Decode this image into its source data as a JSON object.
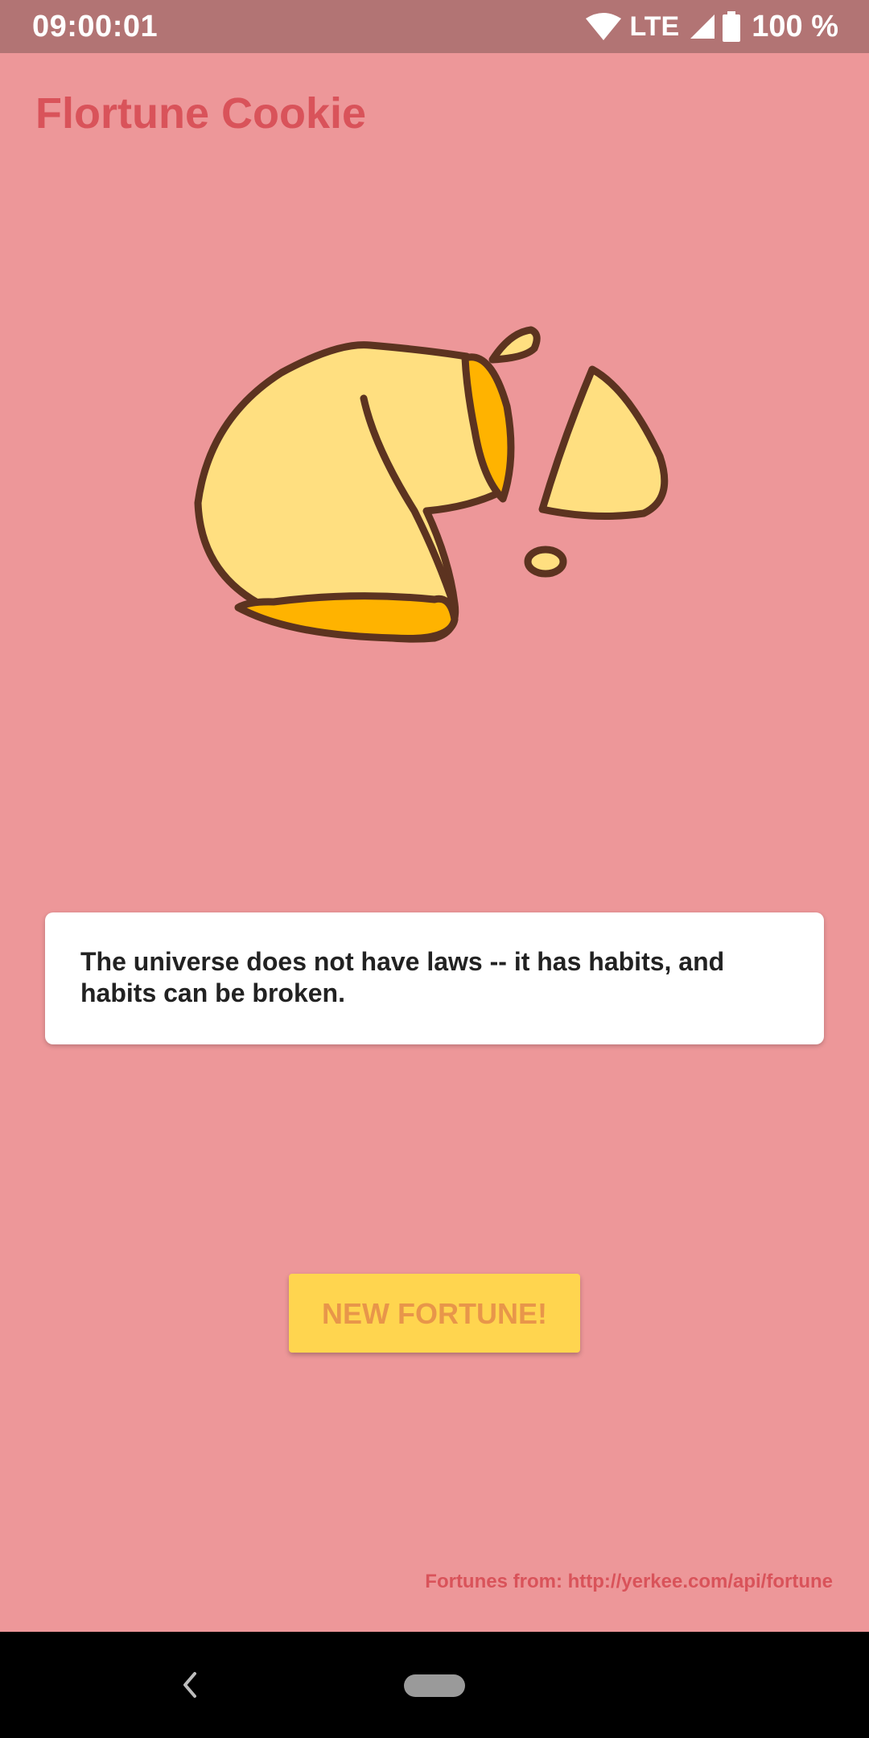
{
  "status_bar": {
    "time": "09:00:01",
    "network": "LTE",
    "battery": "100 %",
    "icons": [
      "wifi-icon",
      "cell-signal-icon",
      "battery-icon"
    ]
  },
  "app": {
    "title": "Flortune Cookie"
  },
  "illustration": {
    "icon": "fortune-cookie-icon",
    "colors": {
      "outline": "#5c3320",
      "fill": "#ffdf80",
      "inner": "#ffb300"
    }
  },
  "fortune": {
    "text": "The universe does not have laws -- it has habits, and habits can be broken."
  },
  "button": {
    "label": "NEW FORTUNE!"
  },
  "footer": {
    "credit": "Fortunes from: http://yerkee.com/api/fortune"
  },
  "navigation": {
    "icons": [
      "back-icon",
      "home-pill-icon"
    ]
  },
  "colors": {
    "background": "#ed9799",
    "status_bar": "#b27474",
    "title": "#d9535a",
    "button": "#ffd54f",
    "button_text": "#e8964a"
  }
}
